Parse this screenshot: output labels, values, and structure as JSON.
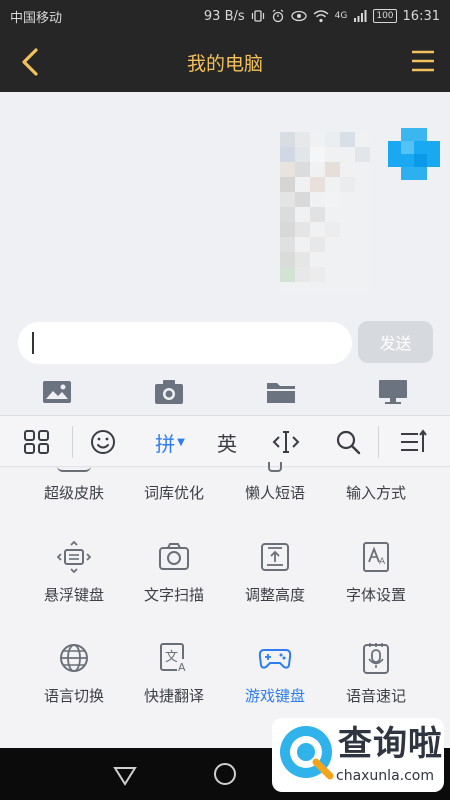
{
  "status_bar": {
    "carrier": "中国移动",
    "speed": "93 B/s",
    "network": "4G",
    "battery": "100",
    "time": "16:31"
  },
  "header": {
    "title": "我的电脑",
    "back_icon": "chevron-left-icon",
    "menu_icon": "hamburger-menu-icon",
    "accent_color": "#f2c15c"
  },
  "composer": {
    "input_value": "",
    "send_label": "发送"
  },
  "attachments": [
    {
      "icon": "image-icon"
    },
    {
      "icon": "camera-icon"
    },
    {
      "icon": "folder-icon"
    },
    {
      "icon": "computer-icon"
    }
  ],
  "keyboard_toolbar": {
    "pinyin_label": "拼",
    "english_label": "英",
    "active_color": "#2e7df0"
  },
  "keyboard_panel": {
    "items": [
      {
        "label": "超级皮肤"
      },
      {
        "label": "词库优化"
      },
      {
        "label": "懒人短语"
      },
      {
        "label": "输入方式"
      },
      {
        "label": "悬浮键盘",
        "icon": "floating-keyboard-icon"
      },
      {
        "label": "文字扫描",
        "icon": "camera-scan-icon"
      },
      {
        "label": "调整高度",
        "icon": "adjust-height-icon"
      },
      {
        "label": "字体设置",
        "icon": "font-settings-icon"
      },
      {
        "label": "语言切换",
        "icon": "globe-icon"
      },
      {
        "label": "快捷翻译",
        "icon": "translate-icon"
      },
      {
        "label": "游戏键盘",
        "icon": "gamepad-icon",
        "selected": true
      },
      {
        "label": "语音速记",
        "icon": "voice-note-icon"
      }
    ]
  },
  "watermark": {
    "text": "查询啦",
    "url": "chaxunla.com"
  }
}
